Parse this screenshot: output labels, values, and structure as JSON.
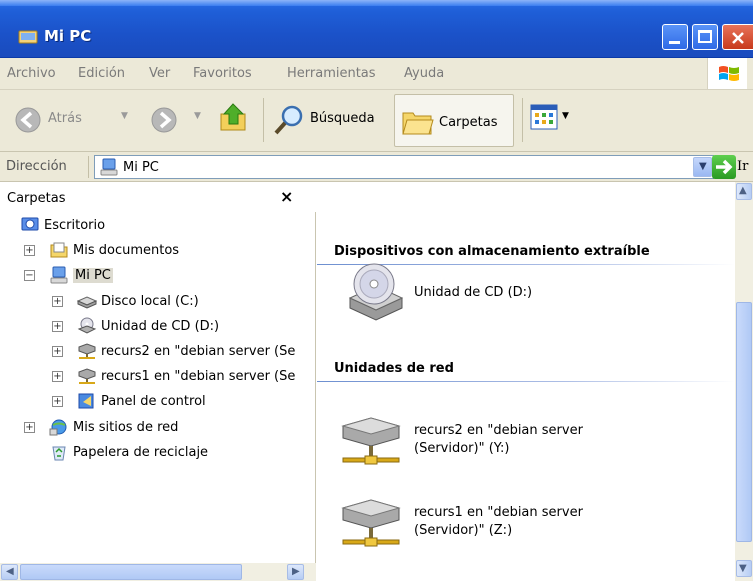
{
  "window": {
    "title": "Mi PC"
  },
  "menu": [
    "Archivo",
    "Edición",
    "Ver",
    "Favoritos",
    "Herramientas",
    "Ayuda"
  ],
  "toolbar": {
    "back_label": "Atrás",
    "search_label": "Búsqueda",
    "folders_label": "Carpetas"
  },
  "address": {
    "label": "Dirección",
    "value": "Mi PC",
    "go_label": "Ir"
  },
  "folder_pane": {
    "title": "Carpetas",
    "close_glyph": "×",
    "tree": [
      {
        "label": "Escritorio",
        "icon": "desktop-icon",
        "level": 0,
        "expander": ""
      },
      {
        "label": "Mis documentos",
        "icon": "documents-folder-icon",
        "level": 1,
        "expander": "+"
      },
      {
        "label": "Mi PC",
        "icon": "my-computer-icon",
        "level": 1,
        "expander": "−",
        "selected": true
      },
      {
        "label": "Disco local (C:)",
        "icon": "hard-disk-icon",
        "level": 2,
        "expander": "+"
      },
      {
        "label": "Unidad de CD (D:)",
        "icon": "cd-drive-icon",
        "level": 2,
        "expander": "+"
      },
      {
        "label": "recurs2 en \"debian server (Se",
        "icon": "network-drive-icon",
        "level": 2,
        "expander": "+"
      },
      {
        "label": "recurs1 en \"debian server (Se",
        "icon": "network-drive-icon",
        "level": 2,
        "expander": "+"
      },
      {
        "label": "Panel de control",
        "icon": "control-panel-icon",
        "level": 2,
        "expander": "+"
      },
      {
        "label": "Mis sitios de red",
        "icon": "network-places-icon",
        "level": 1,
        "expander": "+"
      },
      {
        "label": "Papelera de reciclaje",
        "icon": "recycle-bin-icon",
        "level": 1,
        "expander": ""
      }
    ]
  },
  "content": {
    "groups": [
      {
        "title": "Dispositivos con almacenamiento extraíble",
        "items": [
          {
            "line1": "Unidad de CD (D:)",
            "line2": "",
            "icon": "cd-drive-large-icon"
          }
        ]
      },
      {
        "title": "Unidades de red",
        "items": [
          {
            "line1": "recurs2 en \"debian server",
            "line2": "(Servidor)\" (Y:)",
            "icon": "network-drive-large-icon"
          },
          {
            "line1": "recurs1 en \"debian server",
            "line2": "(Servidor)\" (Z:)",
            "icon": "network-drive-large-icon"
          }
        ]
      }
    ]
  }
}
